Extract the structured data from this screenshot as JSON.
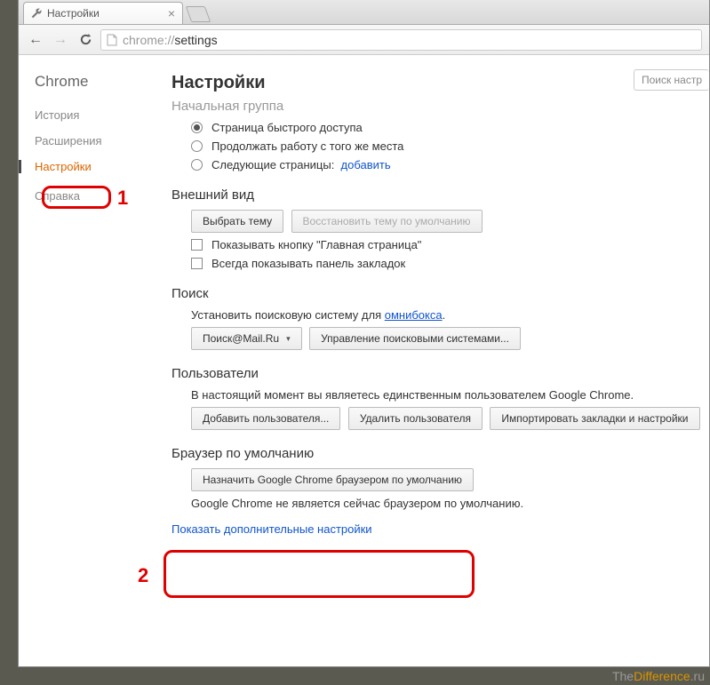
{
  "tab": {
    "title": "Настройки",
    "close": "×"
  },
  "address": {
    "prefix": "chrome://",
    "path": "settings"
  },
  "sidebar": {
    "brand": "Chrome",
    "items": [
      "История",
      "Расширения",
      "Настройки",
      "Справка"
    ]
  },
  "page": {
    "title": "Настройки",
    "search_placeholder": "Поиск настр"
  },
  "startup": {
    "title_cut": "Начальная группа",
    "opt1": "Страница быстрого доступа",
    "opt2": "Продолжать работу с того же места",
    "opt3": "Следующие страницы:",
    "add_link": "добавить"
  },
  "appearance": {
    "title": "Внешний вид",
    "choose_theme": "Выбрать тему",
    "reset_theme": "Восстановить тему по умолчанию",
    "show_home": "Показывать кнопку \"Главная страница\"",
    "show_bookmarks": "Всегда показывать панель закладок"
  },
  "search": {
    "title": "Поиск",
    "desc_pre": "Установить поисковую систему для ",
    "omnibox": "омнибокса",
    "engine": "Поиск@Mail.Ru",
    "manage": "Управление поисковыми системами..."
  },
  "users": {
    "title": "Пользователи",
    "desc": "В настоящий момент вы являетесь единственным пользователем Google Chrome.",
    "add": "Добавить пользователя...",
    "del": "Удалить пользователя",
    "import": "Импортировать закладки и настройки"
  },
  "default_browser": {
    "title": "Браузер по умолчанию",
    "set": "Назначить Google Chrome браузером по умолчанию",
    "status": "Google Chrome не является сейчас браузером по умолчанию."
  },
  "advanced": "Показать дополнительные настройки",
  "annotations": {
    "one": "1",
    "two": "2"
  },
  "watermark": {
    "a": "The",
    "b": "Difference",
    "c": ".ru"
  }
}
